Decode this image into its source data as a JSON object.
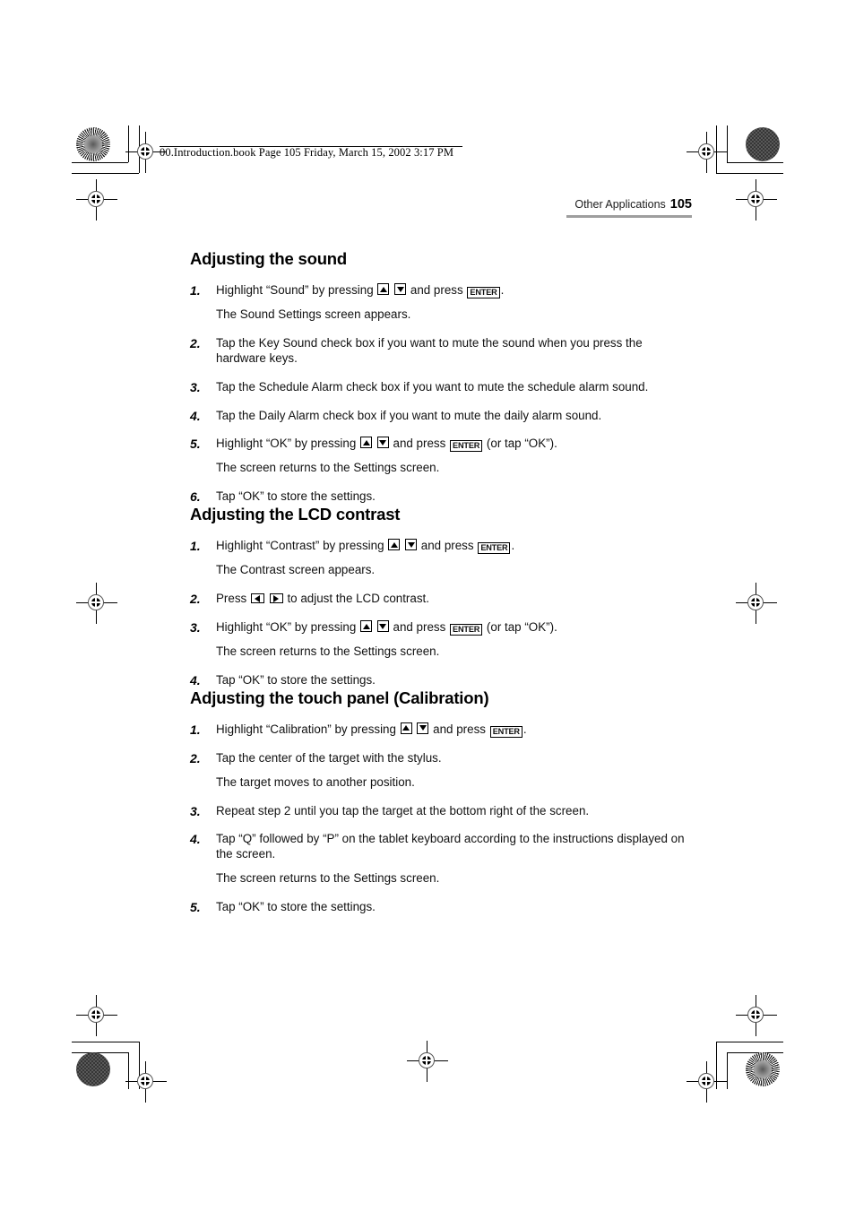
{
  "file_banner": {
    "text": "00.Introduction.book  Page 105  Friday, March 15, 2002  3:17 PM"
  },
  "running_head": {
    "title": "Other Applications",
    "page_number": "105"
  },
  "keys": {
    "up": "up-arrow-key",
    "down": "down-arrow-key",
    "left": "left-arrow-key",
    "right": "right-arrow-key",
    "enter_label": "ENTER"
  },
  "prepress": {
    "star_target": "star-target-mark",
    "solid_dot": "solid-dot-mark",
    "registration": "registration-crosshair-mark"
  },
  "sections": [
    {
      "id": "sound",
      "heading": "Adjusting the sound",
      "steps": [
        {
          "num": "1.",
          "text_before": "Highlight “Sound” by pressing",
          "text_mid": "and press",
          "text_after": ".",
          "result": "The Sound Settings screen appears."
        },
        {
          "num": "2.",
          "text": "Tap the Key Sound check box if you want to mute the sound when you press the hardware keys."
        },
        {
          "num": "3.",
          "text": "Tap the Schedule Alarm check box if you want to mute the schedule alarm sound."
        },
        {
          "num": "4.",
          "text": "Tap the Daily Alarm check box if you want to mute the daily alarm sound."
        },
        {
          "num": "5.",
          "text_before": "Highlight “OK” by pressing",
          "text_mid": "and press",
          "text_after": "(or tap “OK”).",
          "result": "The screen returns to the Settings screen."
        },
        {
          "num": "6.",
          "text": "Tap “OK” to store the settings."
        }
      ]
    },
    {
      "id": "lcd",
      "heading": "Adjusting the LCD contrast",
      "steps": [
        {
          "num": "1.",
          "text_before": "Highlight “Contrast” by pressing",
          "text_mid": "and press",
          "text_after": ".",
          "result": "The Contrast screen appears."
        },
        {
          "num": "2.",
          "text_before": "Press",
          "text_after": "to adjust the LCD contrast."
        },
        {
          "num": "3.",
          "text_before": "Highlight “OK” by pressing",
          "text_mid": "and press",
          "text_after": "(or tap “OK”).",
          "result": "The screen returns to the Settings screen."
        },
        {
          "num": "4.",
          "text": "Tap “OK” to store the settings."
        }
      ]
    },
    {
      "id": "touch",
      "heading": "Adjusting the touch panel (Calibration)",
      "steps": [
        {
          "num": "1.",
          "text_before": "Highlight “Calibration” by pressing",
          "text_mid": "and press",
          "text_after": "."
        },
        {
          "num": "2.",
          "text": "Tap the center of the target with the stylus.",
          "result": "The target moves to another position."
        },
        {
          "num": "3.",
          "text": "Repeat step 2 until you tap the target at the bottom right of the screen."
        },
        {
          "num": "4.",
          "text": "Tap “Q” followed by “P” on the tablet keyboard according to the instructions displayed on the screen.",
          "result": "The screen returns to the Settings screen."
        },
        {
          "num": "5.",
          "text": "Tap “OK” to store the settings."
        }
      ]
    }
  ]
}
